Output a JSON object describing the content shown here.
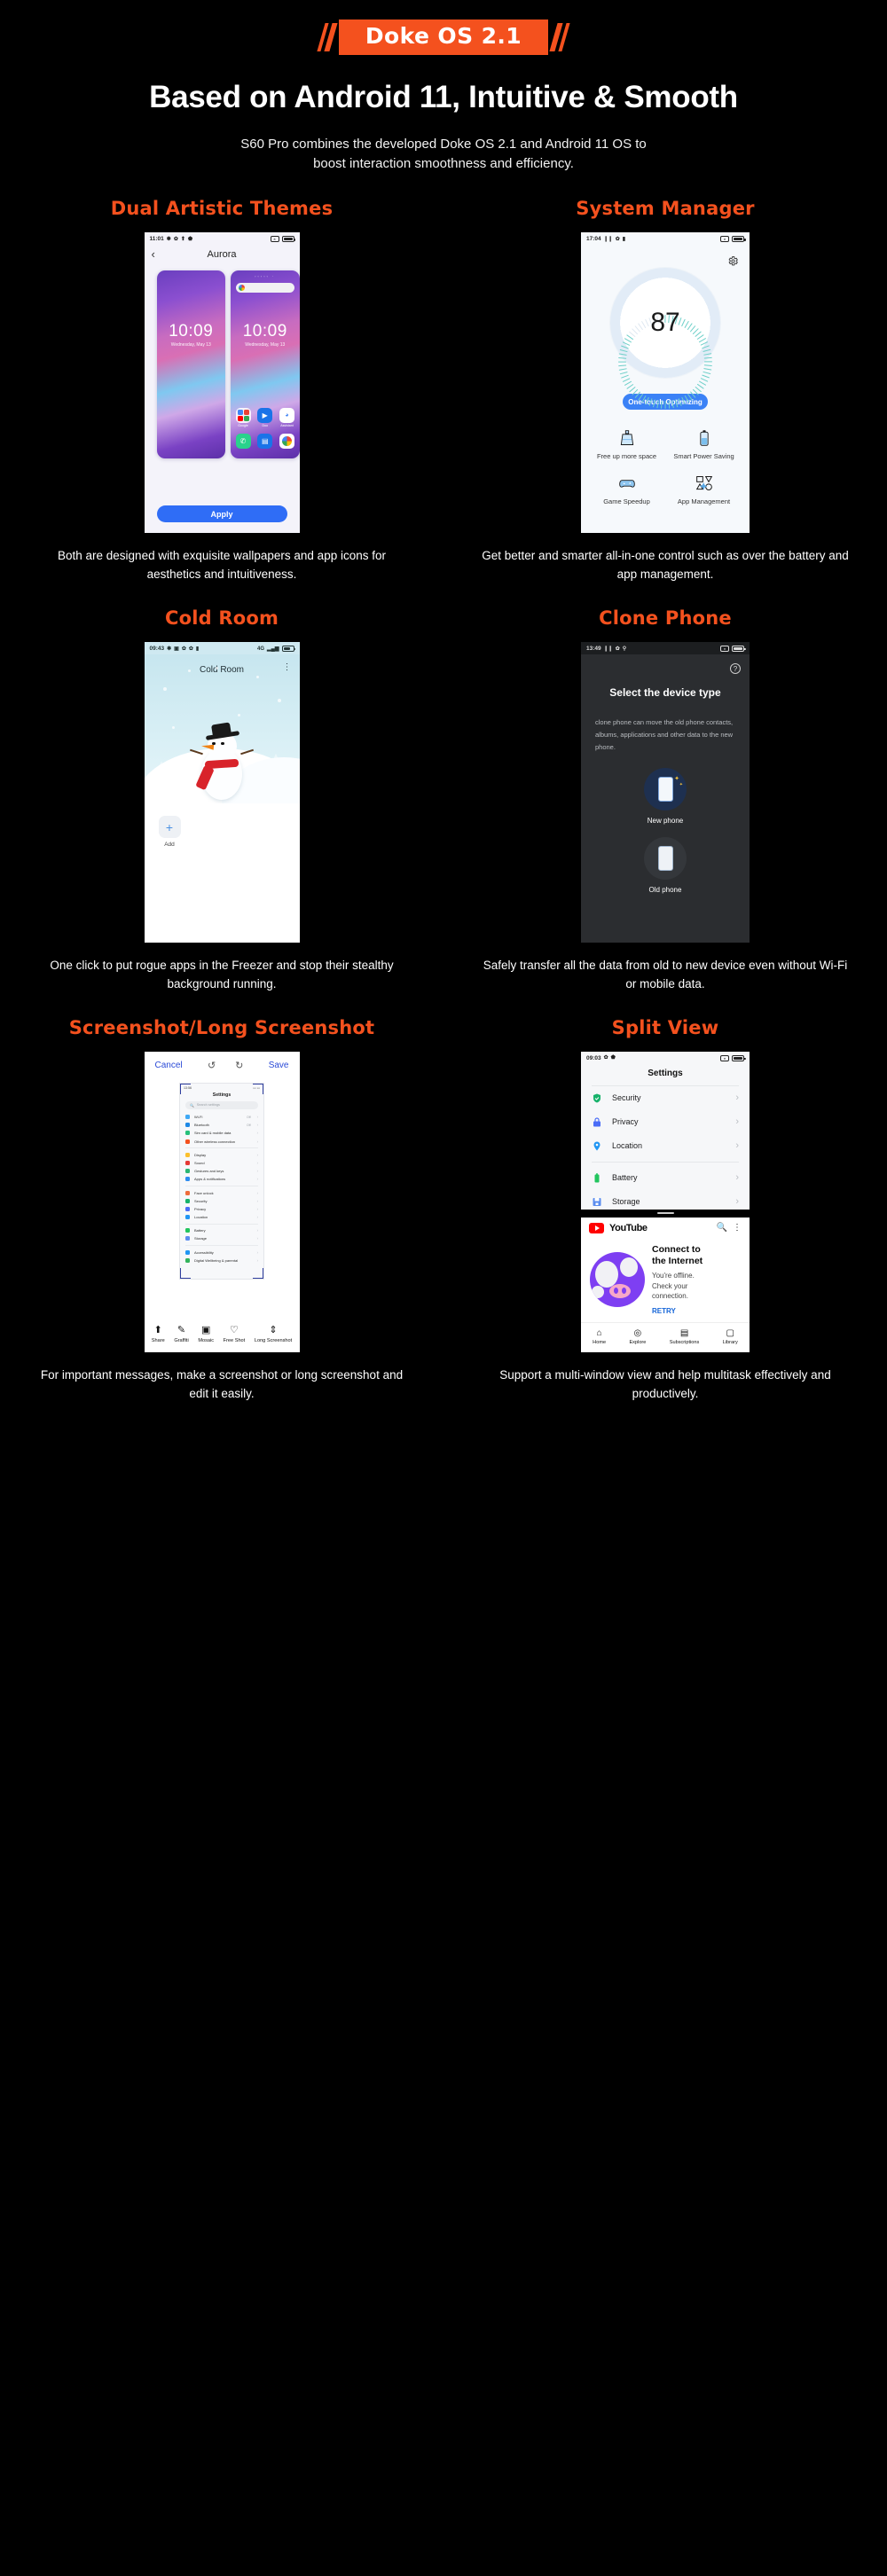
{
  "hero": {
    "badge": "Doke OS 2.1",
    "title": "Based on Android 11, Intuitive & Smooth",
    "sub_line1": "S60 Pro combines the developed Doke OS 2.1 and Android 11 OS to",
    "sub_line2": "boost interaction smoothness and efficiency.",
    "accent": "#f4511e"
  },
  "sections": {
    "themes": {
      "title": "Dual Artistic Themes",
      "caption": "Both are designed with exquisite wallpapers and app icons for aesthetics and intuitiveness.",
      "status_time": "11:01",
      "nav_title": "Aurora",
      "clock_time": "10:09",
      "clock_date": "Wednesday, May 13",
      "apply_label": "Apply",
      "app_labels": [
        "Google",
        "Duo",
        "Assistant"
      ]
    },
    "system_manager": {
      "title": "System Manager",
      "caption": "Get better and smarter all-in-one control such as over the battery and app management.",
      "status_time": "17:04",
      "score": "87",
      "optimize_label": "One-touch Optimizing",
      "tiles": [
        {
          "label": "Free up more space",
          "icon": "broom-icon"
        },
        {
          "label": "Smart Power Saving",
          "icon": "battery-icon"
        },
        {
          "label": "Game Speedup",
          "icon": "gamepad-icon"
        },
        {
          "label": "App Management",
          "icon": "shapes-icon"
        }
      ]
    },
    "cold_room": {
      "title": "Cold Room",
      "caption": "One click to put rogue apps in the Freezer and stop their stealthy background running.",
      "status_time": "09:43",
      "app_title": "Cold Room",
      "add_label": "Add",
      "network": "4G"
    },
    "clone_phone": {
      "title": "Clone Phone",
      "caption": "Safely transfer all the data from old to new device even without Wi-Fi or mobile data.",
      "status_time": "13:49",
      "heading": "Select the device type",
      "body": "clone phone can move the old phone contacts, albums, applications and other data to the new phone.",
      "options": [
        {
          "label": "New phone",
          "icon": "new-phone-icon"
        },
        {
          "label": "Old phone",
          "icon": "old-phone-icon"
        }
      ]
    },
    "screenshot": {
      "title": "Screenshot/Long Screenshot",
      "caption": "For important messages, make a screenshot or long screenshot and edit it easily.",
      "cancel_label": "Cancel",
      "save_label": "Save",
      "inner_status_time": "13:56",
      "inner_title": "Settings",
      "search_placeholder": "Search settings",
      "settings_rows": [
        {
          "label": "Wi-Fi",
          "value": "Off",
          "color": "#3fa9f5"
        },
        {
          "label": "Bluetooth",
          "value": "Off",
          "color": "#1e88e5"
        },
        {
          "label": "Sim card & mobile data",
          "value": "",
          "color": "#27c07a"
        },
        {
          "label": "Other wireless connection",
          "value": "",
          "color": "#f4511e"
        },
        {
          "divider": true
        },
        {
          "label": "Display",
          "value": "",
          "color": "#fbc02d"
        },
        {
          "label": "Sound",
          "value": "",
          "color": "#e53935"
        },
        {
          "label": "Gestures and keys",
          "value": "",
          "color": "#2bb673"
        },
        {
          "label": "Apps & notifications",
          "value": "",
          "color": "#2d8cf0"
        },
        {
          "divider": true
        },
        {
          "label": "Face unlock",
          "value": "",
          "color": "#ef6c3b"
        },
        {
          "label": "Security",
          "value": "",
          "color": "#18b26b"
        },
        {
          "label": "Privacy",
          "value": "",
          "color": "#4a6cf7"
        },
        {
          "label": "Location",
          "value": "",
          "color": "#2196f3"
        },
        {
          "divider": true
        },
        {
          "label": "Battery",
          "value": "",
          "color": "#22c55e"
        },
        {
          "label": "Storage",
          "value": "",
          "color": "#5b8def"
        },
        {
          "divider": true
        },
        {
          "label": "Accessibility",
          "value": "",
          "color": "#2196f3"
        },
        {
          "label": "Digital Wellbeing & parental",
          "value": "",
          "color": "#33b35c"
        }
      ],
      "toolbar": [
        {
          "label": "Share",
          "icon": "share-icon",
          "glyph": "⬆"
        },
        {
          "label": "Graffiti",
          "icon": "graffiti-icon",
          "glyph": "✎"
        },
        {
          "label": "Mosaic",
          "icon": "mosaic-icon",
          "glyph": "▣"
        },
        {
          "label": "Free Shot",
          "icon": "heart-icon",
          "glyph": "♡"
        },
        {
          "label": "Long Screenshot",
          "icon": "long-screenshot-icon",
          "glyph": "⇕"
        }
      ]
    },
    "split_view": {
      "title": "Split View",
      "caption": "Support a multi-window view and help multitask effectively and productively.",
      "status_time": "09:03",
      "settings_title": "Settings",
      "rows": [
        {
          "label": "Security",
          "icon": "shield-check-icon",
          "color": "#18b26b"
        },
        {
          "label": "Privacy",
          "icon": "lock-icon",
          "color": "#4a6cf7"
        },
        {
          "label": "Location",
          "icon": "pin-icon",
          "color": "#2196f3"
        },
        {
          "label": "Battery",
          "icon": "battery-icon",
          "color": "#22c55e"
        },
        {
          "label": "Storage",
          "icon": "floppy-icon",
          "color": "#5b8def"
        }
      ],
      "youtube": {
        "brand": "YouTube",
        "heading_l1": "Connect to",
        "heading_l2": "the Internet",
        "body_l1": "You're offline.",
        "body_l2": "Check your",
        "body_l3": "connection.",
        "retry": "RETRY",
        "nav": [
          {
            "label": "Home",
            "icon": "home-icon",
            "glyph": "⌂"
          },
          {
            "label": "Explore",
            "icon": "compass-icon",
            "glyph": "◎"
          },
          {
            "label": "Subscriptions",
            "icon": "subscriptions-icon",
            "glyph": "▤"
          },
          {
            "label": "Library",
            "icon": "library-icon",
            "glyph": "▢"
          }
        ]
      }
    }
  }
}
